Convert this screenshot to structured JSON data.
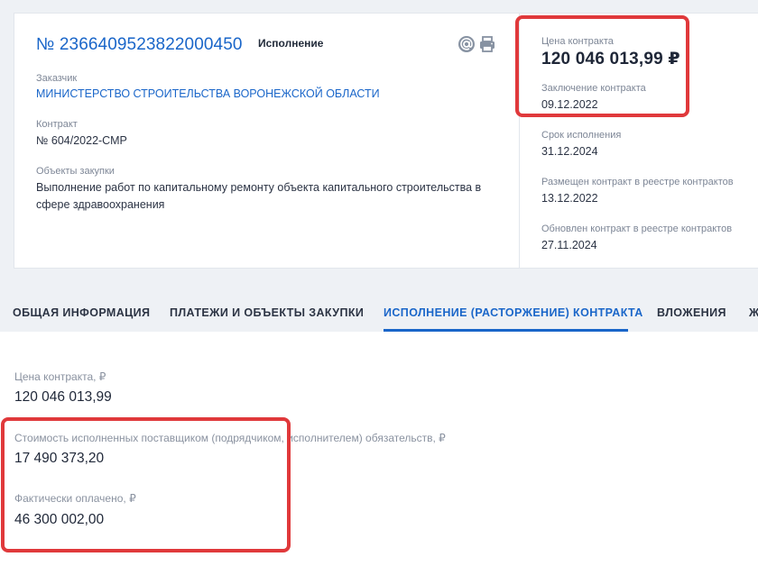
{
  "header": {
    "number": "№ 2366409523822000450",
    "status": "Исполнение",
    "icons": {
      "email": "email-icon",
      "print": "printer-icon"
    }
  },
  "left": {
    "customer_label": "Заказчик",
    "customer_value": "МИНИСТЕРСТВО СТРОИТЕЛЬСТВА ВОРОНЕЖСКОЙ ОБЛАСТИ",
    "contract_label": "Контракт",
    "contract_value": "№ 604/2022-СМР",
    "objects_label": "Объекты закупки",
    "objects_value": "Выполнение работ по капитальному ремонту объекта капитального строительства в сфере здравоохранения"
  },
  "right": {
    "price_label": "Цена контракта",
    "price_value": "120 046 013,99 ₽",
    "conclusion_label": "Заключение контракта",
    "conclusion_value": "09.12.2022",
    "term_label": "Срок исполнения",
    "term_value": "31.12.2024",
    "placed_label": "Размещен контракт в реестре контрактов",
    "placed_value": "13.12.2022",
    "updated_label": "Обновлен контракт в реестре контрактов",
    "updated_value": "27.11.2024"
  },
  "tabs": [
    {
      "label": "ОБЩАЯ ИНФОРМАЦИЯ",
      "active": false
    },
    {
      "label": "ПЛАТЕЖИ И ОБЪЕКТЫ ЗАКУПКИ",
      "active": false
    },
    {
      "label": "ИСПОЛНЕНИЕ (РАСТОРЖЕНИЕ) КОНТРАКТА",
      "active": true
    },
    {
      "label": "ВЛОЖЕНИЯ",
      "active": false
    },
    {
      "label": "Ж",
      "active": false
    }
  ],
  "finance": {
    "price_label": "Цена контракта, ₽",
    "price_value": "120 046 013,99",
    "executed_label": "Стоимость исполненных поставщиком (подрядчиком, исполнителем) обязательств, ₽",
    "executed_value": "17 490 373,20",
    "paid_label": "Фактически оплачено, ₽",
    "paid_value": "46 300 002,00"
  },
  "colors": {
    "accent": "#1a66c9",
    "highlight": "#e0393b",
    "background": "#eef1f5"
  }
}
